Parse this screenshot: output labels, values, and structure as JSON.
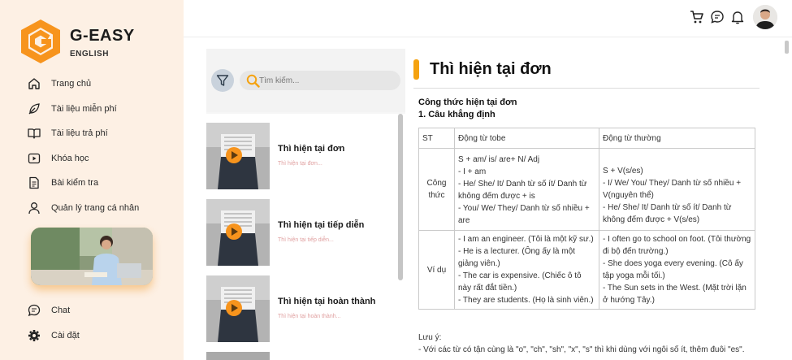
{
  "brand": {
    "name": "G-EASY",
    "subtitle": "ENGLISH",
    "accent_color": "#f7941d"
  },
  "sidebar": {
    "items": [
      {
        "label": "Trang chủ",
        "icon": "home-icon"
      },
      {
        "label": "Tài liệu miễn phí",
        "icon": "leaf-icon"
      },
      {
        "label": "Tài liệu trả phí",
        "icon": "book-open-icon"
      },
      {
        "label": "Khóa học",
        "icon": "video-icon"
      },
      {
        "label": "Bài kiểm tra",
        "icon": "document-icon"
      },
      {
        "label": "Quản lý trang cá nhân",
        "icon": "user-icon"
      }
    ],
    "bottom_items": [
      {
        "label": "Chat",
        "icon": "chat-icon"
      },
      {
        "label": "Cài đặt",
        "icon": "gear-icon"
      }
    ]
  },
  "topbar": {
    "icons": [
      "cart-icon",
      "message-icon",
      "bell-icon"
    ]
  },
  "search": {
    "placeholder": "Tìm kiếm..."
  },
  "lessons": [
    {
      "title": "Thì hiện tại đơn",
      "subtitle": "Thì hiện tại đơn..."
    },
    {
      "title": "Thì hiện tại tiếp diễn",
      "subtitle": "Thì hiện tại tiếp diễn..."
    },
    {
      "title": "Thì hiện tại hoàn thành",
      "subtitle": "Thì hiện tại hoàn thành..."
    }
  ],
  "content": {
    "title": "Thì hiện tại đơn",
    "heading1": "Công thức hiện tại đơn",
    "heading2": "1. Câu khẳng định",
    "table": {
      "headers": [
        "ST",
        "Động từ tobe",
        "Động từ thường"
      ],
      "rows": [
        {
          "label_line1": "Công",
          "label_line2": "thức",
          "tobe": [
            "S + am/ is/ are+ N/ Adj",
            "- I + am",
            "- He/ She/ It/ Danh từ số ít/ Danh từ không đếm được + is",
            "- You/ We/ They/ Danh từ số nhiều + are"
          ],
          "normal": [
            "S + V(s/es)",
            "- I/ We/ You/ They/ Danh từ số nhiều + V(nguyên thể)",
            "- He/ She/ It/ Danh từ số ít/ Danh từ không đếm được + V(s/es)"
          ]
        },
        {
          "label_line1": "Ví dụ",
          "tobe": [
            "- I am an engineer. (Tôi là một kỹ sư.)",
            "- He is a lecturer. (Ông ấy là một giảng viên.)",
            "- The car is expensive. (Chiếc ô tô này rất đắt tiền.)",
            "- They are students. (Họ là sinh viên.)"
          ],
          "normal": [
            "- I often go to school on foot. (Tôi thường đi bộ đến trường.)",
            "- She does yoga every evening. (Cô ấy tập yoga mỗi tối.)",
            "- The Sun sets in the West. (Mặt trời lặn ở hướng Tây.)"
          ]
        }
      ]
    },
    "note_label": "Lưu ý:",
    "note_text": "- Với các từ có tận cùng là \"o\", \"ch\", \"sh\", \"x\", \"s\" thì khi dùng với ngôi số ít, thêm đuôi \"es\"."
  }
}
